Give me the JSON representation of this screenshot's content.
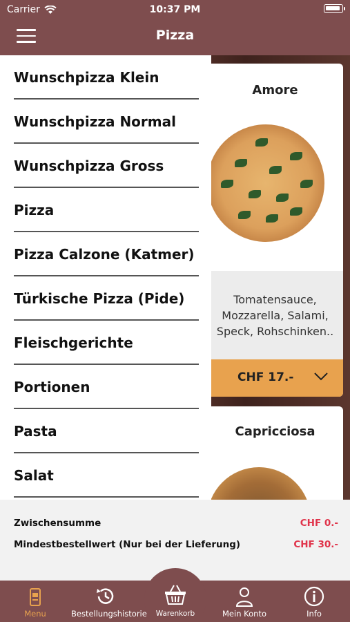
{
  "status": {
    "carrier": "Carrier",
    "time": "10:37 PM"
  },
  "nav": {
    "title": "Pizza"
  },
  "drawer": {
    "items": [
      {
        "label": "Wunschpizza Klein"
      },
      {
        "label": "Wunschpizza Normal"
      },
      {
        "label": "Wunschpizza Gross"
      },
      {
        "label": "Pizza"
      },
      {
        "label": "Pizza Calzone (Katmer)"
      },
      {
        "label": "Türkische Pizza (Pide)"
      },
      {
        "label": "Fleischgerichte"
      },
      {
        "label": "Portionen"
      },
      {
        "label": "Pasta"
      },
      {
        "label": "Salat"
      }
    ]
  },
  "products": [
    {
      "name": "Amore",
      "desc1": "Tomatensauce,",
      "desc2": "Mozzarella, Salami,",
      "desc3": "Speck, Rohschinken..",
      "price": "CHF 17.-"
    },
    {
      "name": "Capricciosa"
    }
  ],
  "summary": {
    "subtotal_label": "Zwischensumme",
    "subtotal_value": "CHF 0.-",
    "minimum_label": "Mindestbestellwert (Nur bei der Lieferung)",
    "minimum_value": "CHF 30.-"
  },
  "tabs": {
    "menu": "Menu",
    "history": "Bestellungshistorie",
    "cart": "Warenkorb",
    "account": "Mein Konto",
    "info": "Info"
  },
  "colors": {
    "brand": "#7e4d4e",
    "accent": "#e8a24e",
    "price_red": "#e0334a"
  }
}
